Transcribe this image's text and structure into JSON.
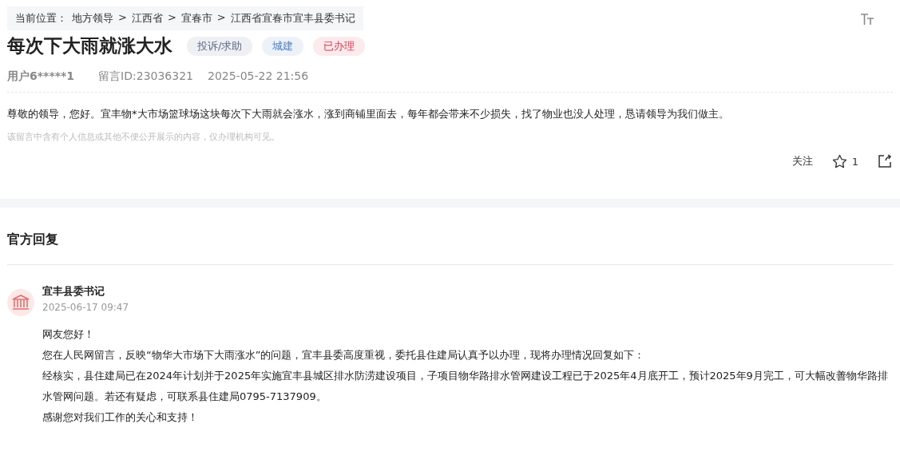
{
  "breadcrumb": {
    "label": "当前位置：",
    "separator": ">",
    "items": [
      "地方领导",
      "江西省",
      "宜春市",
      "江西省宜春市宜丰县委书记"
    ]
  },
  "title": "每次下大雨就涨大水",
  "tags": [
    {
      "text": "投诉/求助",
      "color": "#5a6a85"
    },
    {
      "text": "城建",
      "color": "#4a7fc1"
    },
    {
      "text": "已办理",
      "color": "#e0374a"
    }
  ],
  "meta": {
    "user": "用户6*****1",
    "message_id": "留言ID:23036321",
    "time": "2025-05-22 21:56"
  },
  "message": "尊敬的领导，您好。宜丰物*大市场篮球场这块每次下大雨就会涨水，涨到商铺里面去，每年都会带来不少损失，找了物业也没人处理，恳请领导为我们做主。",
  "privacy_note": "该留言中含有个人信息或其他不便公开展示的内容，仅办理机构可见。",
  "actions": {
    "follow": "关注",
    "likes": "1"
  },
  "reply": {
    "heading": "官方回复",
    "author": "宜丰县委书记",
    "time": "2025-06-17 09:47",
    "paragraphs": [
      "网友您好！",
      "您在人民网留言，反映“物华大市场下大雨涨水”的问题，宜丰县委高度重视，委托县住建局认真予以办理，现将办理情况回复如下：",
      "经核实，县住建局已在2024年计划并于2025年实施宜丰县城区排水防涝建设项目，子项目物华路排水管网建设工程已于2025年4月底开工，预计2025年9月完工，可大幅改善物华路排水管网问题。若还有疑虑，可联系县住建局0795-7137909。",
      "感谢您对我们工作的关心和支持！"
    ]
  }
}
